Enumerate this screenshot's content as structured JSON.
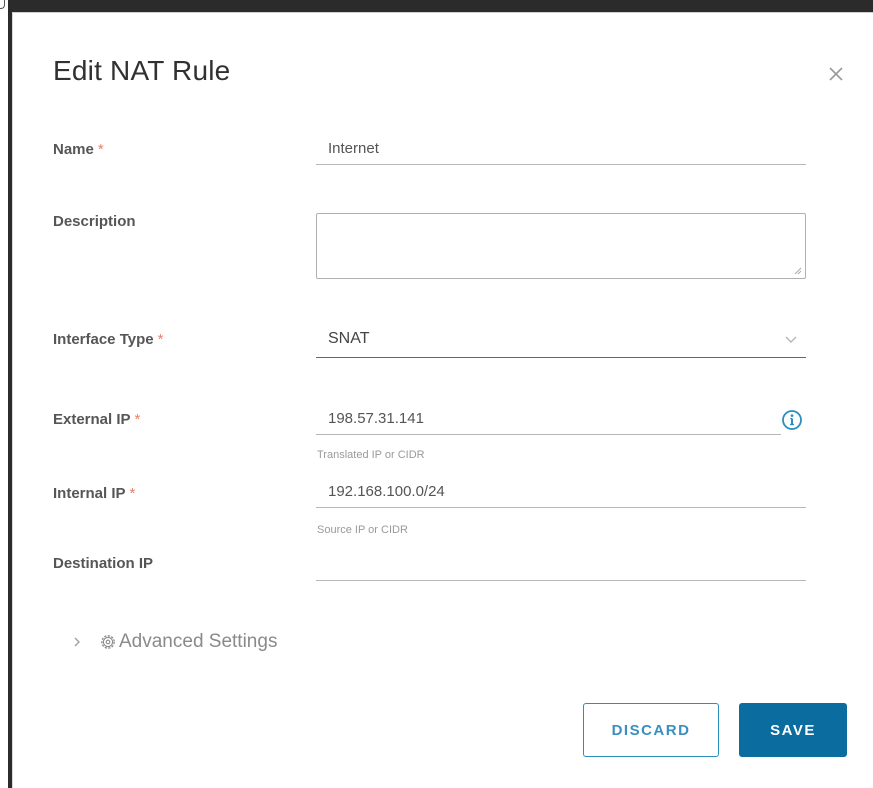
{
  "dialog": {
    "title": "Edit NAT Rule",
    "close_icon": "close-icon"
  },
  "form": {
    "required_marker": "*",
    "name": {
      "label": "Name",
      "required": true,
      "value": "Internet"
    },
    "description": {
      "label": "Description",
      "required": false,
      "value": ""
    },
    "interface_type": {
      "label": "Interface Type",
      "required": true,
      "selected": "SNAT",
      "icon": "chevron-down-icon"
    },
    "external_ip": {
      "label": "External IP",
      "required": true,
      "value": "198.57.31.141",
      "hint": "Translated IP or CIDR",
      "icon": "info-icon"
    },
    "internal_ip": {
      "label": "Internal IP",
      "required": true,
      "value": "192.168.100.0/24",
      "hint": "Source IP or CIDR"
    },
    "destination_ip": {
      "label": "Destination IP",
      "required": false,
      "value": ""
    }
  },
  "advanced": {
    "label": "Advanced Settings",
    "expanded": false,
    "icons": [
      "chevron-right-icon",
      "gear-icon"
    ]
  },
  "actions": {
    "discard_label": "DISCARD",
    "save_label": "SAVE"
  },
  "colors": {
    "primary": "#0a6c9f",
    "outline": "#2b8fbd",
    "required": "#e8806c",
    "info": "#2b8fbd"
  }
}
